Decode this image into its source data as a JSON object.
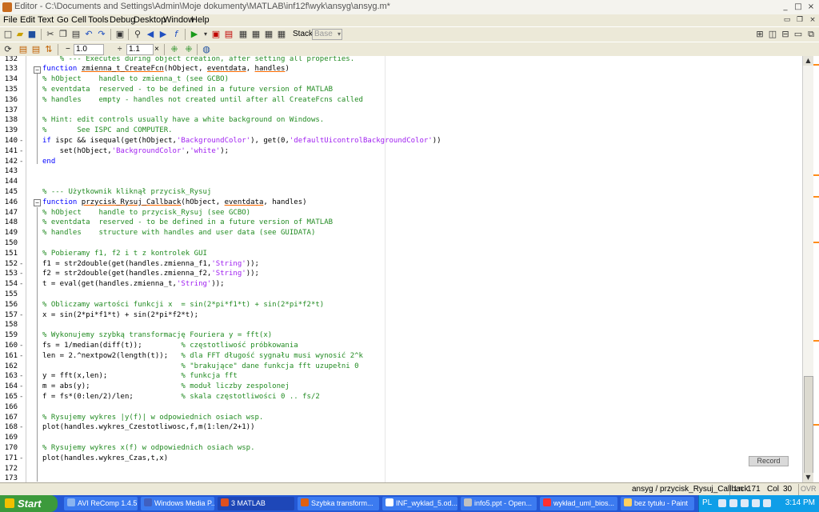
{
  "window": {
    "title": "Editor - C:\\Documents and Settings\\Admin\\Moje dokumenty\\MATLAB\\inf12f\\wyk\\ansyg\\ansyg.m*"
  },
  "menu": [
    "File",
    "Edit",
    "Text",
    "Go",
    "Cell",
    "Tools",
    "Debug",
    "Desktop",
    "Window",
    "Help"
  ],
  "toolbar": {
    "stack_label": "Stack:",
    "stack_value": "Base",
    "cell_minus": "−",
    "cell_value1": "1.0",
    "cell_plus": "+",
    "cell_divide": "÷",
    "cell_value2": "1.1",
    "cell_times": "×"
  },
  "icons": {
    "new": "new-file-icon",
    "open": "open-icon",
    "save": "save-icon",
    "cut": "cut-icon",
    "copy": "copy-icon",
    "paste": "paste-icon",
    "undo": "undo-icon",
    "redo": "redo-icon",
    "print": "print-icon",
    "find": "binoculars-icon",
    "back": "back-arrow-icon",
    "forward": "forward-arrow-icon",
    "fx": "function-icon",
    "run": "run-icon",
    "breakpoint": "breakpoint-icon"
  },
  "code_lines": [
    {
      "n": "132",
      "dash": "",
      "html": "    <span class=\"c\">% --- Executes during object creation, after setting all properties.</span>"
    },
    {
      "n": "133",
      "dash": "",
      "fold": "−",
      "html": "<span class=\"k\">function</span> <span class=\"u\">zmienna_t_CreateFcn</span>(hObject, <span class=\"u\">eventdata</span>, <span class=\"u\">handles</span>)"
    },
    {
      "n": "134",
      "dash": "",
      "html": "<span class=\"c\">% hObject    handle to zmienna_t (see GCBO)</span>"
    },
    {
      "n": "135",
      "dash": "",
      "html": "<span class=\"c\">% eventdata  reserved - to be defined in a future version of MATLAB</span>"
    },
    {
      "n": "136",
      "dash": "",
      "html": "<span class=\"c\">% handles    empty - handles not created until after all CreateFcns called</span>"
    },
    {
      "n": "137",
      "dash": "",
      "html": ""
    },
    {
      "n": "138",
      "dash": "",
      "html": "<span class=\"c\">% Hint: edit controls usually have a white background on Windows.</span>"
    },
    {
      "n": "139",
      "dash": "",
      "html": "<span class=\"c\">%       See ISPC and COMPUTER.</span>"
    },
    {
      "n": "140",
      "dash": "-",
      "html": "<span class=\"k\">if</span> ispc &amp;&amp; isequal(get(hObject,<span class=\"s\">'BackgroundColor'</span>), get(0,<span class=\"s\">'defaultUicontrolBackgroundColor'</span>))"
    },
    {
      "n": "141",
      "dash": "-",
      "html": "    set(hObject,<span class=\"s\">'BackgroundColor'</span>,<span class=\"s\">'white'</span>);"
    },
    {
      "n": "142",
      "dash": "-",
      "html": "<span class=\"k\">end</span>"
    },
    {
      "n": "143",
      "dash": "",
      "html": ""
    },
    {
      "n": "144",
      "dash": "",
      "html": ""
    },
    {
      "n": "145",
      "dash": "",
      "html": "<span class=\"c\">% --- Użytkownik kliknął przycisk_Rysuj</span>"
    },
    {
      "n": "146",
      "dash": "",
      "fold": "−",
      "html": "<span class=\"k\">function</span> <span class=\"u\">przycisk_Rysuj_Callback</span>(hObject, <span class=\"u\">eventdata</span>, handles)"
    },
    {
      "n": "147",
      "dash": "",
      "html": "<span class=\"c\">% hObject    handle to przycisk_Rysuj (see GCBO)</span>"
    },
    {
      "n": "148",
      "dash": "",
      "html": "<span class=\"c\">% eventdata  reserved - to be defined in a future version of MATLAB</span>"
    },
    {
      "n": "149",
      "dash": "",
      "html": "<span class=\"c\">% handles    structure with handles and user data (see GUIDATA)</span>"
    },
    {
      "n": "150",
      "dash": "",
      "html": ""
    },
    {
      "n": "151",
      "dash": "",
      "html": "<span class=\"c\">% Pobieramy f1, f2 i t z kontrolek GUI</span>"
    },
    {
      "n": "152",
      "dash": "-",
      "html": "f1 = str2double(get(handles.zmienna_f1,<span class=\"s\">'String'</span>));"
    },
    {
      "n": "153",
      "dash": "-",
      "html": "f2 = str2double(get(handles.zmienna_f2,<span class=\"s\">'String'</span>));"
    },
    {
      "n": "154",
      "dash": "-",
      "html": "t = eval(get(handles.zmienna_t,<span class=\"s\">'String'</span>));"
    },
    {
      "n": "155",
      "dash": "",
      "html": ""
    },
    {
      "n": "156",
      "dash": "",
      "html": "<span class=\"c\">% Obliczamy wartości funkcji x  = sin(2*pi*f1*t) + sin(2*pi*f2*t)</span>"
    },
    {
      "n": "157",
      "dash": "-",
      "html": "x = sin(2*pi*f1*t) + sin(2*pi*f2*t);"
    },
    {
      "n": "158",
      "dash": "",
      "html": ""
    },
    {
      "n": "159",
      "dash": "",
      "html": "<span class=\"c\">% Wykonujemy szybką transformację Fouriera y = fft(x)</span>"
    },
    {
      "n": "160",
      "dash": "-",
      "html": "fs = 1/median(diff(t));         <span class=\"c\">% częstotliwość próbkowania</span>"
    },
    {
      "n": "161",
      "dash": "-",
      "html": "len = 2.^nextpow2(length(t));   <span class=\"c\">% dla FFT długość sygnału musi wynosić 2^k</span>"
    },
    {
      "n": "162",
      "dash": "",
      "html": "                                <span class=\"c\">% \"brakujące\" dane funkcja fft uzupełni 0</span>"
    },
    {
      "n": "163",
      "dash": "-",
      "html": "y = fft(x,len);                 <span class=\"c\">% funkcja fft</span>"
    },
    {
      "n": "164",
      "dash": "-",
      "html": "m = abs(y);                     <span class=\"c\">% moduł liczby zespolonej</span>"
    },
    {
      "n": "165",
      "dash": "-",
      "html": "f = fs*(0:len/2)/len;           <span class=\"c\">% skala częstotliwości 0 .. fs/2</span>"
    },
    {
      "n": "166",
      "dash": "",
      "html": ""
    },
    {
      "n": "167",
      "dash": "",
      "html": "<span class=\"c\">% Rysujemy wykres |y(f)| w odpowiednich osiach wsp.</span>"
    },
    {
      "n": "168",
      "dash": "-",
      "html": "plot(handles.wykres_Czestotliwosc,f,m(1:len/2+1))"
    },
    {
      "n": "169",
      "dash": "",
      "html": ""
    },
    {
      "n": "170",
      "dash": "",
      "html": "<span class=\"c\">% Rysujemy wykres x(f) w odpowiednich osiach wsp.</span>"
    },
    {
      "n": "171",
      "dash": "-",
      "html": "plot(handles.wykres_Czas,t,x)"
    },
    {
      "n": "172",
      "dash": "",
      "html": ""
    },
    {
      "n": "173",
      "dash": "",
      "html": ""
    }
  ],
  "record_label": "Record",
  "status": {
    "function": "ansyg / przycisk_Rysuj_Callback",
    "ln_label": "Ln",
    "ln_value": "171",
    "col_label": "Col",
    "col_value": "30",
    "ovr": "OVR"
  },
  "taskbar": {
    "start": "Start",
    "tasks": [
      {
        "label": "AVI ReComp 1.4.5",
        "color": "#8ab4f0"
      },
      {
        "label": "Windows Media P...",
        "color": "#4060c0"
      },
      {
        "label": "3 MATLAB",
        "color": "#e05020"
      },
      {
        "label": "Szybka transform...",
        "color": "#e06010"
      },
      {
        "label": "INF_wyklad_5.od...",
        "color": "#ffffff"
      },
      {
        "label": "info5.ppt - Open...",
        "color": "#c0c0c0"
      },
      {
        "label": "wykład_uml_bios...",
        "color": "#ff3030"
      },
      {
        "label": "bez tytułu - Paint",
        "color": "#ffd060"
      }
    ],
    "lang": "PL",
    "clock": "3:14 PM"
  },
  "colors": {
    "keyword": "#0000ff",
    "comment": "#228b22",
    "string": "#a020f0",
    "taskbar": "#2458d4",
    "start": "#3c9a3c",
    "marker": "#ff8c1a"
  }
}
